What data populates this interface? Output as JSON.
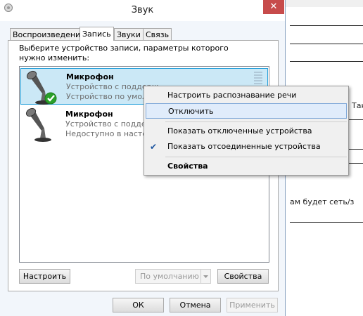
{
  "window": {
    "title": "Звук"
  },
  "tabs": [
    {
      "label": "Воспроизведение"
    },
    {
      "label": "Запись"
    },
    {
      "label": "Звуки"
    },
    {
      "label": "Связь"
    }
  ],
  "instruction": "Выберите устройство записи, параметры которого нужно изменить:",
  "devices": [
    {
      "name": "Микрофон",
      "line1": "Устройство с поддерж",
      "line2": "Устройство по умолча",
      "status_icon": "green-check-icon",
      "selected": true
    },
    {
      "name": "Микрофон",
      "line1": "Устройство с поддерж",
      "line2": "Недоступно в настоя",
      "status_icon": "down-arrow-icon",
      "selected": false
    }
  ],
  "buttons": {
    "configure": "Настроить",
    "default": "По умолчанию",
    "properties": "Свойства",
    "ok": "ОК",
    "cancel": "Отмена",
    "apply": "Применить"
  },
  "context_menu": {
    "items": [
      {
        "label": "Настроить распознавание речи"
      },
      {
        "label": "Отключить"
      },
      {
        "label": "Показать отключенные устройства"
      },
      {
        "label": "Показать отсоединенные устройства",
        "checked": true
      },
      {
        "label": "Свойства",
        "bold": true
      }
    ]
  },
  "background_doc": {
    "text_1": "Так",
    "text_2": "ам будет сеть/з"
  },
  "colors": {
    "selection": "#cbe8f6",
    "accent": "#26a0da",
    "close": "#c74b4b",
    "check_green": "#2aa02a"
  }
}
